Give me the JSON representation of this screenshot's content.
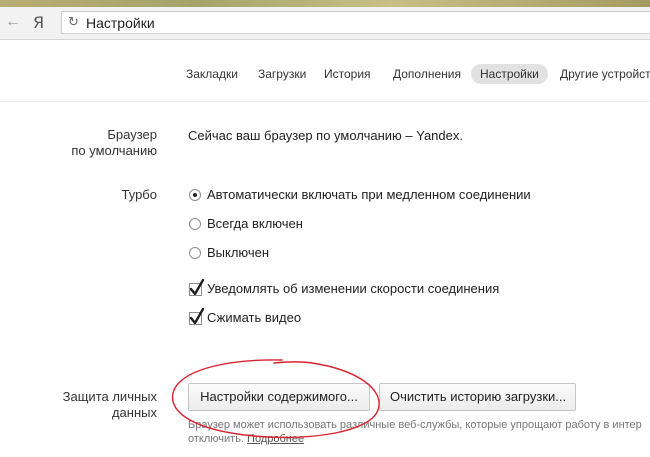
{
  "browser": {
    "brand": "Я",
    "address": "Настройки",
    "icons": {
      "back": "back-arrow-icon",
      "reload": "reload-icon"
    }
  },
  "tabs": [
    {
      "label": "Закладки",
      "active": false
    },
    {
      "label": "Загрузки",
      "active": false
    },
    {
      "label": "История",
      "active": false
    },
    {
      "label": "Дополнения",
      "active": false
    },
    {
      "label": "Настройки",
      "active": true
    },
    {
      "label": "Другие устройства",
      "active": false
    }
  ],
  "default_browser": {
    "label_line1": "Браузер",
    "label_line2": "по умолчанию",
    "status": "Сейчас ваш браузер по умолчанию – Yandex."
  },
  "turbo": {
    "label": "Турбо",
    "options": [
      {
        "label": "Автоматически включать при медленном соединении",
        "checked": true
      },
      {
        "label": "Всегда включен",
        "checked": false
      },
      {
        "label": "Выключен",
        "checked": false
      }
    ],
    "checkboxes": [
      {
        "label": "Уведомлять об изменении скорости соединения",
        "checked": true
      },
      {
        "label": "Сжимать видео",
        "checked": true
      }
    ]
  },
  "privacy": {
    "label_line1": "Защита личных",
    "label_line2": "данных",
    "content_settings_button": "Настройки содержимого...",
    "clear_history_button": "Очистить историю загрузки...",
    "note_text": "Браузер может использовать различные веб-службы, которые упрощают работу в интер",
    "note_text2": "отключить.",
    "note_link": "Подробнее"
  },
  "colors": {
    "annotation": "#d9232e",
    "active_tab_bg": "#e2e2e2",
    "checkmark": "#1f1f1f"
  }
}
